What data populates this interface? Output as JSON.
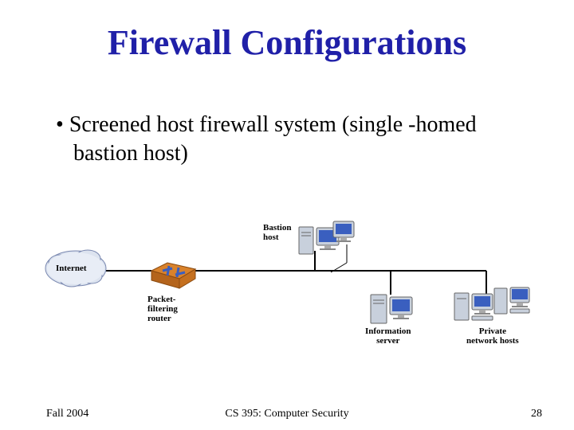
{
  "title": "Firewall Configurations",
  "bullet": "Screened host firewall system (single -homed bastion host)",
  "diagram": {
    "labels": {
      "internet": "Internet",
      "router": "Packet-\nfiltering\nrouter",
      "bastion": "Bastion\nhost",
      "info_server": "Information\nserver",
      "private_hosts": "Private\nnetwork hosts"
    }
  },
  "footer": {
    "left": "Fall 2004",
    "center": "CS 395: Computer Security",
    "right": "28"
  }
}
